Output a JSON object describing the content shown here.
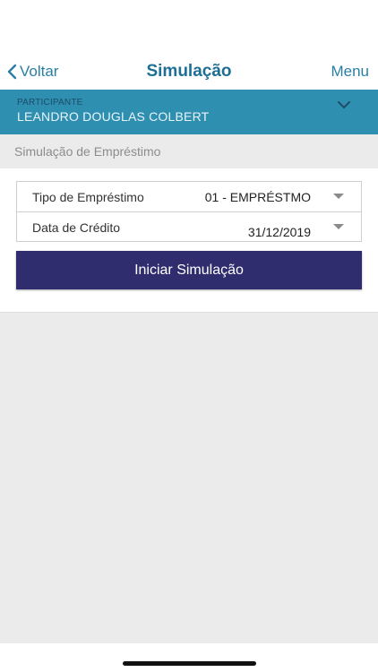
{
  "nav": {
    "back_label": "Voltar",
    "title": "Simulação",
    "menu_label": "Menu"
  },
  "participant": {
    "label": "PARTICIPANTE",
    "name": "LEANDRO DOUGLAS COLBERT"
  },
  "section": {
    "title": "Simulação de Empréstimo"
  },
  "form": {
    "loan_type": {
      "label": "Tipo de Empréstimo",
      "value": "01 - EMPRÉSTMO"
    },
    "credit_date": {
      "label": "Data de Crédito",
      "value": "31/12/2019"
    },
    "submit_label": "Iniciar Simulação"
  },
  "colors": {
    "nav_text": "#2a7fa5",
    "participant_bar": "#2f8fb1",
    "primary_button": "#2f2d6e",
    "background": "#ebebeb"
  },
  "icons": {
    "back": "chevron-left-icon",
    "participant_toggle": "chevron-down-icon",
    "dropdown": "caret-down-icon"
  }
}
